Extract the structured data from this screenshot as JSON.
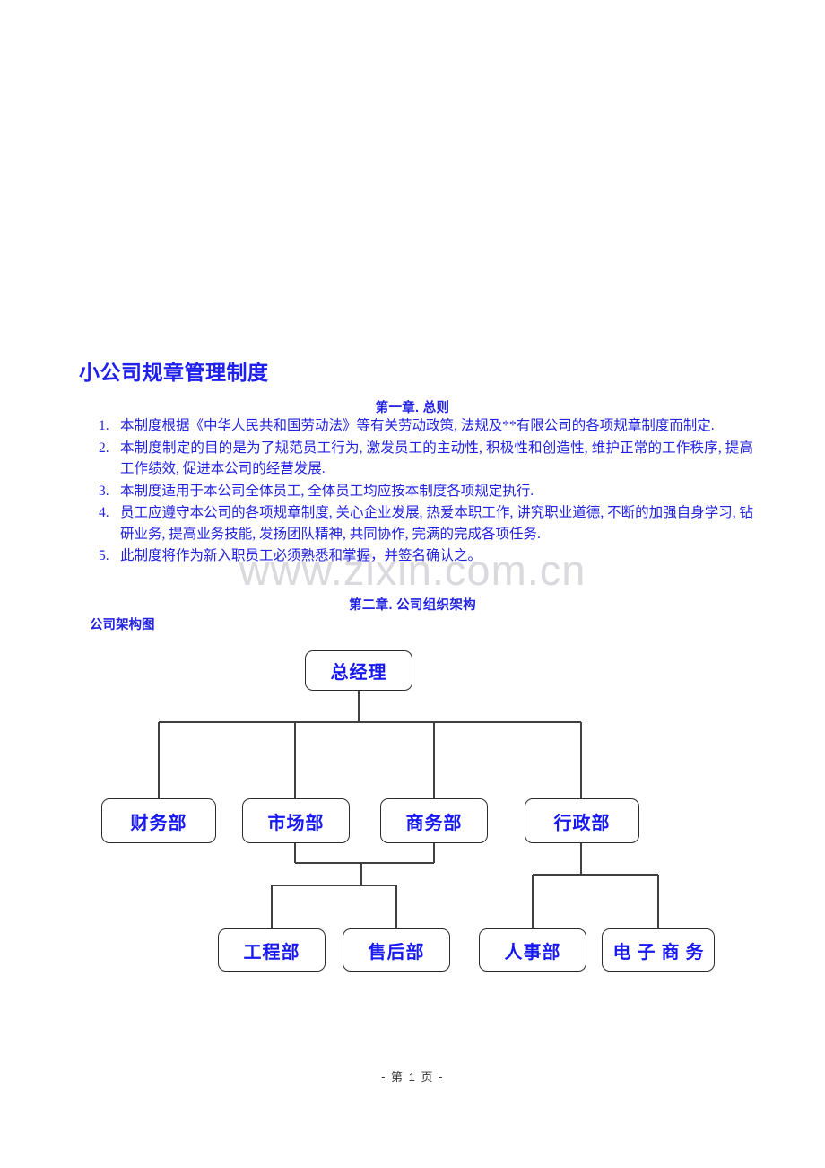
{
  "document": {
    "title": "小公司规章管理制度",
    "watermark": "www.zixin.com.cn",
    "footer": "- 第 1 页 -"
  },
  "chapters": [
    {
      "heading": "第一章.  总则"
    },
    {
      "heading": "第二章.  公司组织架构"
    }
  ],
  "clauses": [
    {
      "num": "1.",
      "text": "本制度根据《中华人民共和国劳动法》等有关劳动政策, 法规及**有限公司的各项规章制度而制定."
    },
    {
      "num": "2.",
      "text": "本制度制定的目的是为了规范员工行为, 激发员工的主动性, 积极性和创造性, 维护正常的工作秩序, 提高工作绩效, 促进本公司的经营发展."
    },
    {
      "num": "3.",
      "text": "本制度适用于本公司全体员工, 全体员工均应按本制度各项规定执行."
    },
    {
      "num": "4.",
      "text": "员工应遵守本公司的各项规章制度, 关心企业发展, 热爱本职工作, 讲究职业道德, 不断的加强自身学习, 钻研业务, 提高业务技能, 发扬团队精神, 共同协作, 完满的完成各项任务."
    },
    {
      "num": "5.",
      "text": "此制度将作为新入职员工必须熟悉和掌握，并签名确认之。"
    }
  ],
  "orgchart": {
    "label": "公司架构图",
    "colors": {
      "box_border": "#2b2b2b",
      "box_text": "#1818f0",
      "connector": "#404040"
    },
    "nodes": {
      "root": {
        "label": "总经理"
      },
      "level1": [
        {
          "label": "财务部"
        },
        {
          "label": "市场部"
        },
        {
          "label": "商务部"
        },
        {
          "label": "行政部"
        }
      ],
      "level2": [
        {
          "label": "工程部"
        },
        {
          "label": "售后部"
        },
        {
          "label": "人事部"
        },
        {
          "label": "电子商务"
        }
      ]
    }
  }
}
